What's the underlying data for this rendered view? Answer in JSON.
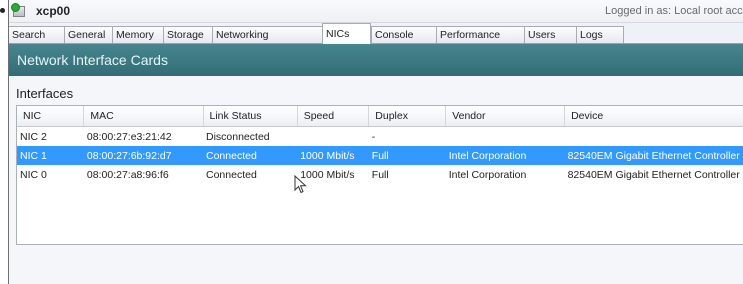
{
  "window": {
    "server_name": "xcp00",
    "logged_in_text": "Logged in as:  Local root account"
  },
  "tabs": [
    {
      "label": "Search",
      "active": false
    },
    {
      "label": "General",
      "active": false
    },
    {
      "label": "Memory",
      "active": false
    },
    {
      "label": "Storage",
      "active": false
    },
    {
      "label": "Networking",
      "active": false
    },
    {
      "label": "NICs",
      "active": true
    },
    {
      "label": "Console",
      "active": false
    },
    {
      "label": "Performance",
      "active": false
    },
    {
      "label": "Users",
      "active": false
    },
    {
      "label": "Logs",
      "active": false
    }
  ],
  "page": {
    "header": "Network Interface Cards",
    "section_title": "Interfaces"
  },
  "table": {
    "columns": [
      "NIC",
      "MAC",
      "Link Status",
      "Speed",
      "Duplex",
      "Vendor",
      "Device"
    ],
    "rows": [
      {
        "nic": "NIC 2",
        "mac": "08:00:27:e3:21:42",
        "link_status": "Disconnected",
        "speed": "",
        "duplex": "-",
        "vendor": "",
        "device": "",
        "selected": false
      },
      {
        "nic": "NIC 1",
        "mac": "08:00:27:6b:92:d7",
        "link_status": "Connected",
        "speed": "1000 Mbit/s",
        "duplex": "Full",
        "vendor": "Intel Corporation",
        "device": "82540EM Gigabit Ethernet Controller",
        "selected": true
      },
      {
        "nic": "NIC 0",
        "mac": "08:00:27:a8:96:f6",
        "link_status": "Connected",
        "speed": "1000 Mbit/s",
        "duplex": "Full",
        "vendor": "Intel Corporation",
        "device": "82540EM Gigabit Ethernet Controller",
        "selected": false
      }
    ]
  },
  "icons": {
    "server": "server-status-icon",
    "cursor": "mouse-pointer-icon"
  },
  "colors": {
    "header_teal": "#3d7a83",
    "selection_blue": "#3399ff",
    "status_green": "#2fa83a"
  }
}
